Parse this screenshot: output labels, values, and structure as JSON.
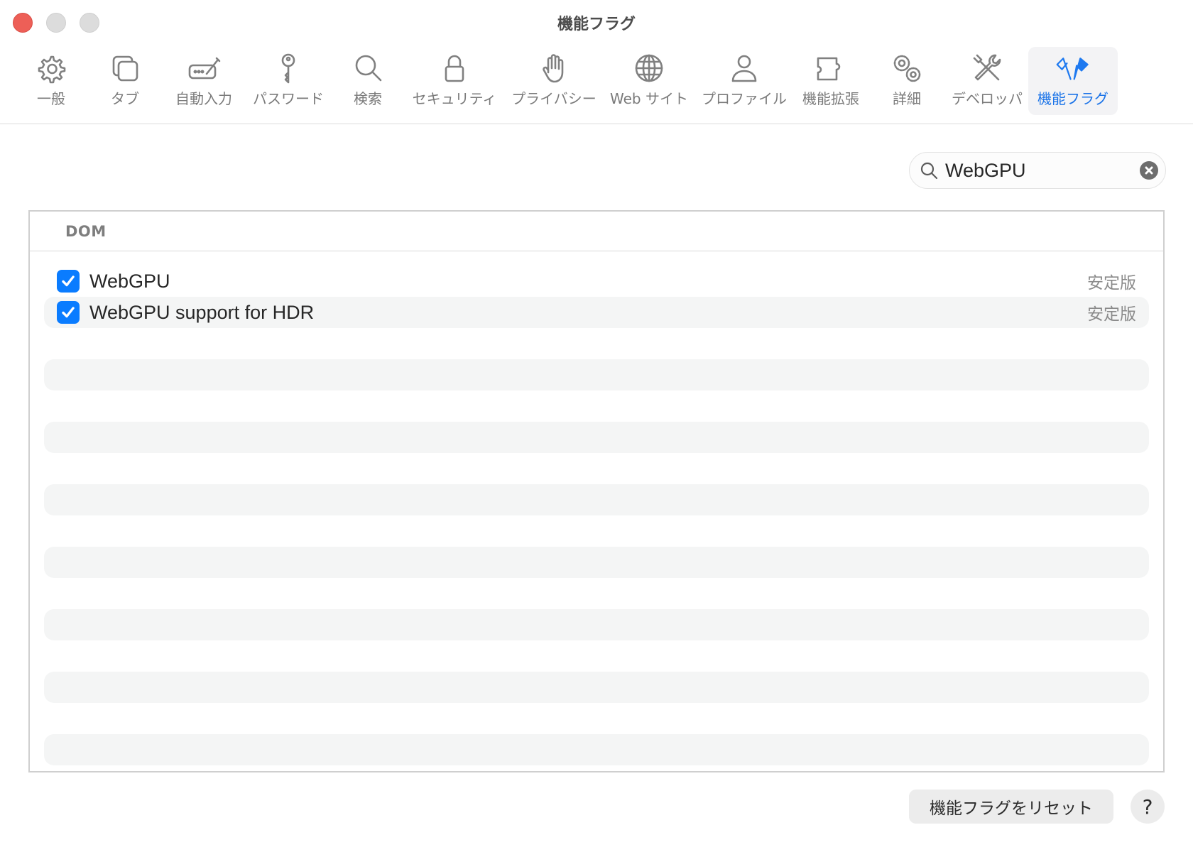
{
  "window": {
    "title": "機能フラグ"
  },
  "toolbar": {
    "items": [
      {
        "label": "一般",
        "icon": "gear-icon"
      },
      {
        "label": "タブ",
        "icon": "tabs-icon"
      },
      {
        "label": "自動入力",
        "icon": "autofill-icon"
      },
      {
        "label": "パスワード",
        "icon": "key-icon"
      },
      {
        "label": "検索",
        "icon": "search-icon"
      },
      {
        "label": "セキュリティ",
        "icon": "lock-icon"
      },
      {
        "label": "プライバシー",
        "icon": "hand-icon"
      },
      {
        "label": "Web サイト",
        "icon": "globe-icon"
      },
      {
        "label": "プロファイル",
        "icon": "person-icon"
      },
      {
        "label": "機能拡張",
        "icon": "puzzle-icon"
      },
      {
        "label": "詳細",
        "icon": "gears-icon"
      },
      {
        "label": "デベロッパ",
        "icon": "tools-icon"
      },
      {
        "label": "機能フラグ",
        "icon": "flags-icon",
        "active": true
      }
    ],
    "active_color": "#1e79f0"
  },
  "search": {
    "value": "WebGPU",
    "placeholder": "検索"
  },
  "section": {
    "header": "DOM"
  },
  "flags": [
    {
      "label": "WebGPU",
      "checked": true,
      "status": "安定版"
    },
    {
      "label": "WebGPU support for HDR",
      "checked": true,
      "status": "安定版"
    }
  ],
  "footer": {
    "reset_label": "機能フラグをリセット",
    "help_label": "?"
  },
  "colors": {
    "checkbox": "#0a7cff",
    "close": "#ed5f57"
  }
}
